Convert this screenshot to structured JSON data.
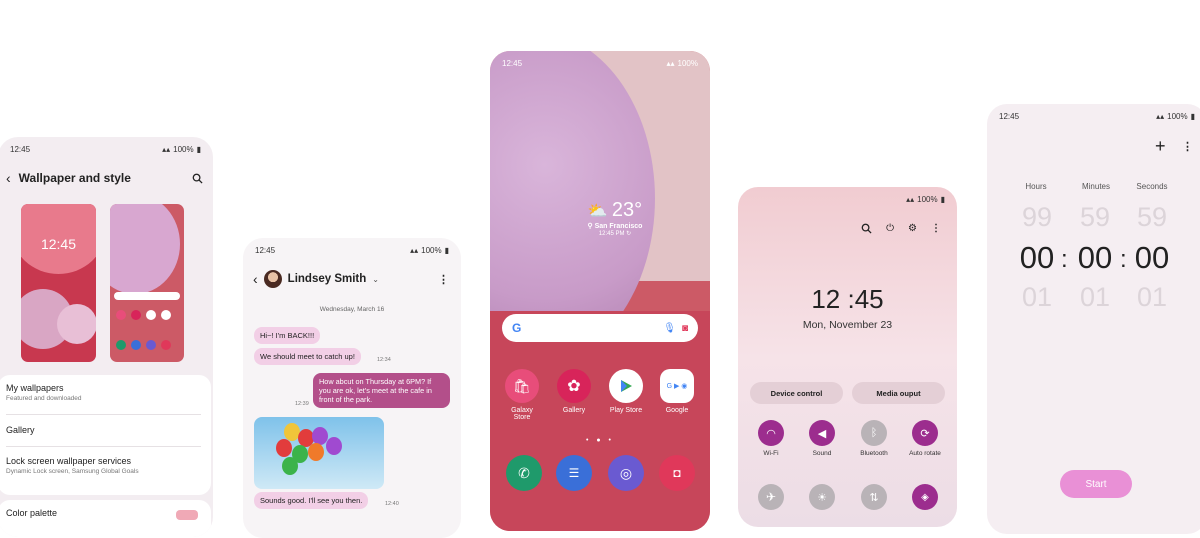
{
  "phone1": {
    "status": {
      "time": "12:45",
      "battery": "100%"
    },
    "title": "Wallpaper and style",
    "preview_lock_time": "12:45",
    "items": [
      {
        "label": "My wallpapers",
        "sub": "Featured and downloaded"
      },
      {
        "label": "Gallery",
        "sub": ""
      },
      {
        "label": "Lock screen wallpaper services",
        "sub": "Dynamic Lock screen, Samsung Global Goals"
      },
      {
        "label": "Color palette",
        "sub": ""
      }
    ]
  },
  "phone2": {
    "status": {
      "time": "12:45",
      "battery": "100%"
    },
    "contact": "Lindsey Smith",
    "date": "Wednesday, March 16",
    "messages": [
      {
        "text": "Hi~! I'm BACK!!!"
      },
      {
        "text": "We should meet to catch up!",
        "time": "12:34"
      },
      {
        "text": "How abcut on Thursday at 6PM? If you are ok, let's meet at the cafe in front of the park.",
        "time": "12:39"
      },
      {
        "text": "Sounds good. I'll see you then.",
        "time": "12:40"
      }
    ]
  },
  "phone3": {
    "status": {
      "time": "12:45",
      "battery": "100%"
    },
    "weather": {
      "temp": "23°",
      "city": "San Francisco",
      "updated": "12:45 PM"
    },
    "apps": [
      {
        "label": "Galaxy Store",
        "icon": "bag-icon",
        "color": "#e84d7a"
      },
      {
        "label": "Gallery",
        "icon": "flower-icon",
        "color": "#d8245a"
      },
      {
        "label": "Play Store",
        "icon": "play-icon",
        "color": "#ffffff"
      },
      {
        "label": "Google",
        "icon": "google-folder-icon",
        "color": "#ffffff"
      }
    ],
    "dock": [
      {
        "icon": "phone-icon",
        "color": "#1f9a6b"
      },
      {
        "icon": "messages-icon",
        "color": "#3a6fd8"
      },
      {
        "icon": "internet-icon",
        "color": "#6a5ad1"
      },
      {
        "icon": "camera-icon",
        "color": "#e0385a"
      }
    ]
  },
  "phone4": {
    "status": {
      "battery": "100%"
    },
    "time": "12 :45",
    "date": "Mon, November 23",
    "buttons": [
      "Device control",
      "Media ouput"
    ],
    "toggles": [
      {
        "label": "Wi-Fi",
        "icon": "wifi-icon",
        "on": true
      },
      {
        "label": "Sound",
        "icon": "sound-icon",
        "on": true
      },
      {
        "label": "Bluetooth",
        "icon": "bluetooth-icon",
        "on": false
      },
      {
        "label": "Auto rotate",
        "icon": "rotate-icon",
        "on": true
      },
      {
        "label": "",
        "icon": "airplane-icon",
        "on": false
      },
      {
        "label": "",
        "icon": "flashlight-icon",
        "on": false
      },
      {
        "label": "",
        "icon": "data-transfer-icon",
        "on": false
      },
      {
        "label": "",
        "icon": "cast-icon",
        "on": true
      }
    ],
    "accent": "#9c2d8e"
  },
  "phone5": {
    "status": {
      "time": "12:45",
      "battery": "100%"
    },
    "labels": [
      "Hours",
      "Minutes",
      "Seconds"
    ],
    "above": [
      "99",
      "59",
      "59"
    ],
    "current": [
      "00",
      "00",
      "00"
    ],
    "below": [
      "01",
      "01",
      "01"
    ],
    "start": "Start"
  }
}
